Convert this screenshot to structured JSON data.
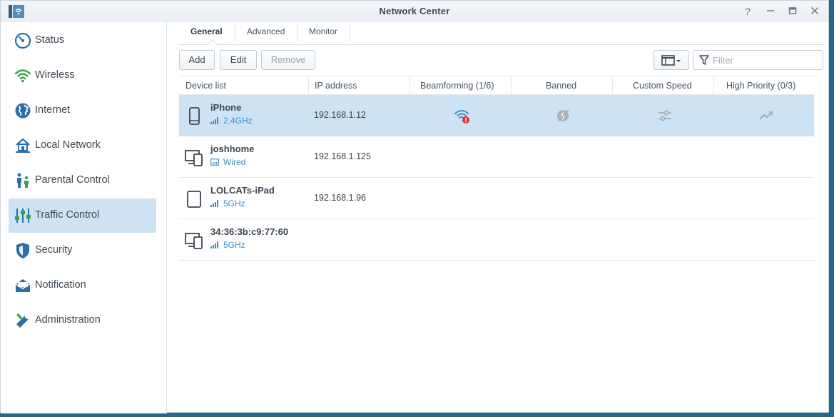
{
  "window": {
    "title": "Network Center"
  },
  "sidebar": {
    "items": [
      {
        "label": "Status",
        "icon": "gauge-icon"
      },
      {
        "label": "Wireless",
        "icon": "wifi-icon"
      },
      {
        "label": "Internet",
        "icon": "globe-icon"
      },
      {
        "label": "Local Network",
        "icon": "home-network-icon"
      },
      {
        "label": "Parental Control",
        "icon": "family-icon"
      },
      {
        "label": "Traffic Control",
        "icon": "sliders-icon",
        "active": true
      },
      {
        "label": "Security",
        "icon": "shield-icon"
      },
      {
        "label": "Notification",
        "icon": "envelope-icon"
      },
      {
        "label": "Administration",
        "icon": "wrench-icon"
      }
    ]
  },
  "tabs": [
    "General",
    "Advanced",
    "Monitor"
  ],
  "toolbar": {
    "add": "Add",
    "edit": "Edit",
    "remove": "Remove",
    "filter_placeholder": "Filter"
  },
  "table": {
    "headers": [
      "Device list",
      "IP address",
      "Beamforming (1/6)",
      "Banned",
      "Custom Speed",
      "High Priority (0/3)"
    ],
    "rows": [
      {
        "name": "iPhone",
        "connection": "2.4GHz",
        "ip": "192.168.1.12",
        "device_icon": "phone-icon",
        "conn_icon": "signal-icon",
        "selected": true
      },
      {
        "name": "joshhome",
        "connection": "Wired",
        "ip": "192.168.1.125",
        "device_icon": "desktop-laptop-icon",
        "conn_icon": "ethernet-icon"
      },
      {
        "name": "LOLCATs-iPad",
        "connection": "5GHz",
        "ip": "192.168.1.96",
        "device_icon": "tablet-icon",
        "conn_icon": "signal-icon"
      },
      {
        "name": "34:36:3b:c9:77:60",
        "connection": "5GHz",
        "ip": "",
        "device_icon": "desktop-laptop-icon",
        "conn_icon": "signal-icon"
      }
    ]
  },
  "colors": {
    "accent": "#3f8fc4",
    "selected_row": "#cde3f3",
    "alert": "#e0332f"
  }
}
